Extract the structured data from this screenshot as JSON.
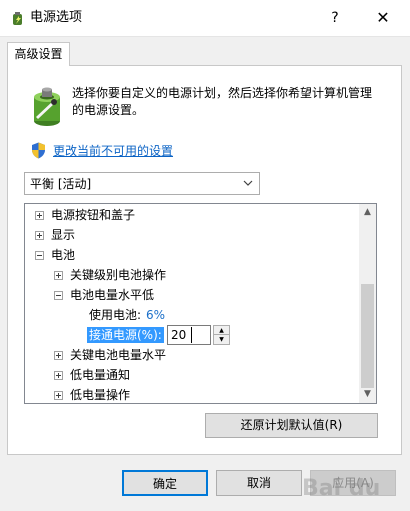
{
  "window": {
    "title": "电源选项",
    "help_label": "?",
    "close_label": "✕"
  },
  "tab": {
    "label": "高级设置"
  },
  "description": "选择你要自定义的电源计划，然后选择你希望计算机管理的电源设置。",
  "change_link": "更改当前不可用的设置",
  "plan_select": {
    "value": "平衡 [活动]"
  },
  "tree": {
    "items": [
      {
        "label": "电源按钮和盖子",
        "state": "collapsed"
      },
      {
        "label": "显示",
        "state": "collapsed"
      },
      {
        "label": "电池",
        "state": "expanded"
      },
      {
        "label": "关键级别电池操作",
        "state": "collapsed"
      },
      {
        "label": "电池电量水平低",
        "state": "expanded"
      },
      {
        "label": "使用电池:",
        "value": "6%"
      },
      {
        "label": "接通电源(%):",
        "value": "20"
      },
      {
        "label": "关键电池电量水平",
        "state": "collapsed"
      },
      {
        "label": "低电量通知",
        "state": "collapsed"
      },
      {
        "label": "低电量操作",
        "state": "collapsed"
      }
    ]
  },
  "buttons": {
    "restore": "还原计划默认值(R)",
    "ok": "确定",
    "cancel": "取消",
    "apply": "应用(A)"
  },
  "watermark": "Bai du",
  "colors": {
    "link": "#0b63c5",
    "selection": "#3399ff",
    "default_button_border": "#0078d7"
  }
}
